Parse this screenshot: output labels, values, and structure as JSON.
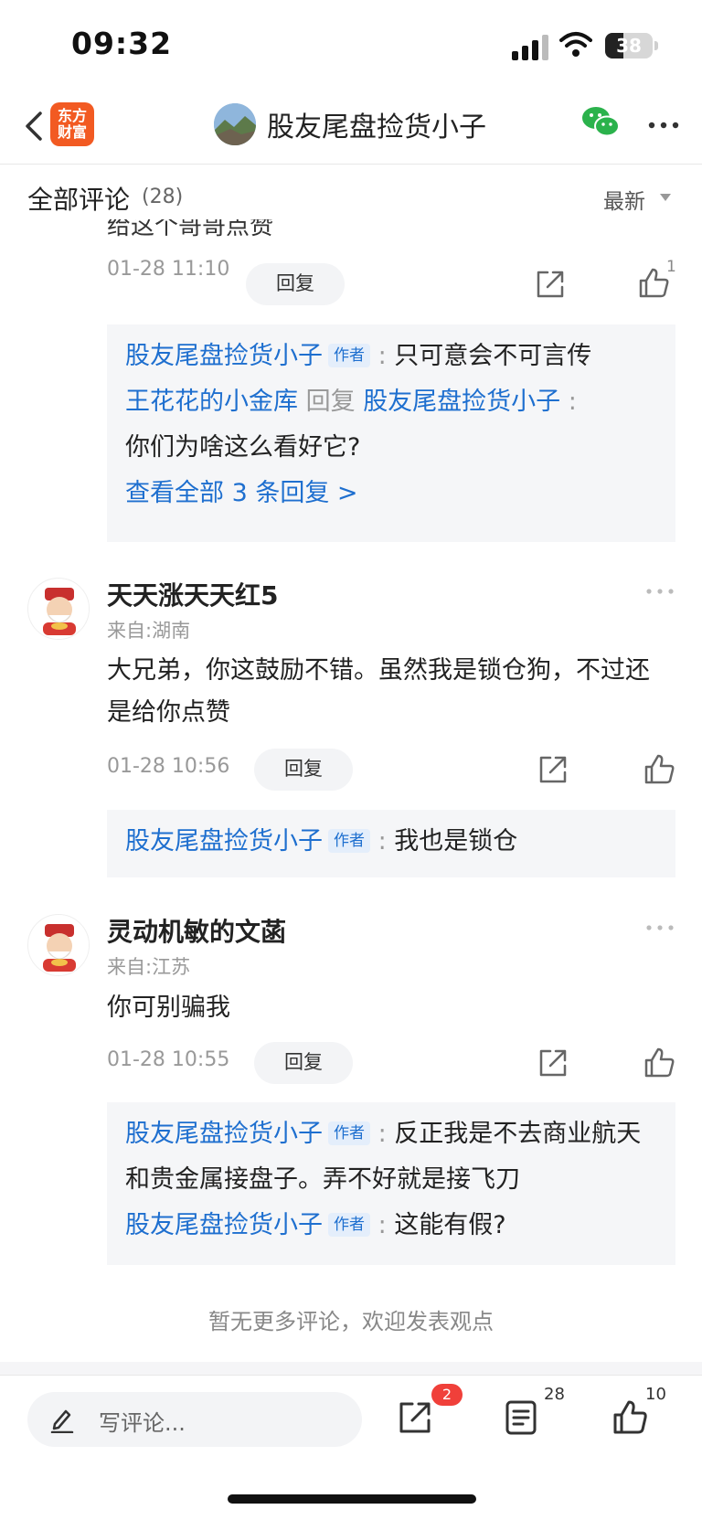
{
  "status_bar": {
    "time": "09:32",
    "battery": "38"
  },
  "nav": {
    "app_logo": "东方\n财富",
    "title": "股友尾盘捡货小子"
  },
  "comments_header": {
    "title": "全部评论",
    "count": "(28)",
    "sort": "最新"
  },
  "clipped_text": "给这个哥哥点赞",
  "comment0": {
    "date": "01-28 11:10",
    "reply_label": "回复",
    "like_count": "1",
    "replies": {
      "r1_user": "股友尾盘捡货小子",
      "r1_tag": "作者",
      "r1_text": "只可意会不可言传",
      "r2_user": "王花花的小金库",
      "r2_mid": "回复",
      "r2_target": "股友尾盘捡货小子",
      "r2_text": "你们为啥这么看好它?",
      "view_all": "查看全部 3 条回复 >"
    }
  },
  "comment1": {
    "username": "天天涨天天红5",
    "location": "来自:湖南",
    "body": "大兄弟，你这鼓励不错。虽然我是锁仓狗，不过还是给你点赞",
    "date": "01-28 10:56",
    "reply_label": "回复",
    "replies": {
      "r1_user": "股友尾盘捡货小子",
      "r1_tag": "作者",
      "r1_text": "我也是锁仓"
    }
  },
  "comment2": {
    "username": "灵动机敏的文菡",
    "location": "来自:江苏",
    "body": "你可别骗我",
    "date": "01-28 10:55",
    "reply_label": "回复",
    "replies": {
      "r1_user": "股友尾盘捡货小子",
      "r1_tag": "作者",
      "r1_text": "反正我是不去商业航天和贵金属接盘子。弄不好就是接飞刀",
      "r2_user": "股友尾盘捡货小子",
      "r2_tag": "作者",
      "r2_text": "这能有假?"
    }
  },
  "no_more": "暂无更多评论，欢迎发表观点",
  "bottom_bar": {
    "placeholder": "写评论...",
    "share_badge": "2",
    "comments_count": "28",
    "likes_count": "10"
  },
  "colors": {
    "link_blue": "#1e6fcf",
    "brand_orange": "#f25a22",
    "badge_red": "#f0403a"
  }
}
